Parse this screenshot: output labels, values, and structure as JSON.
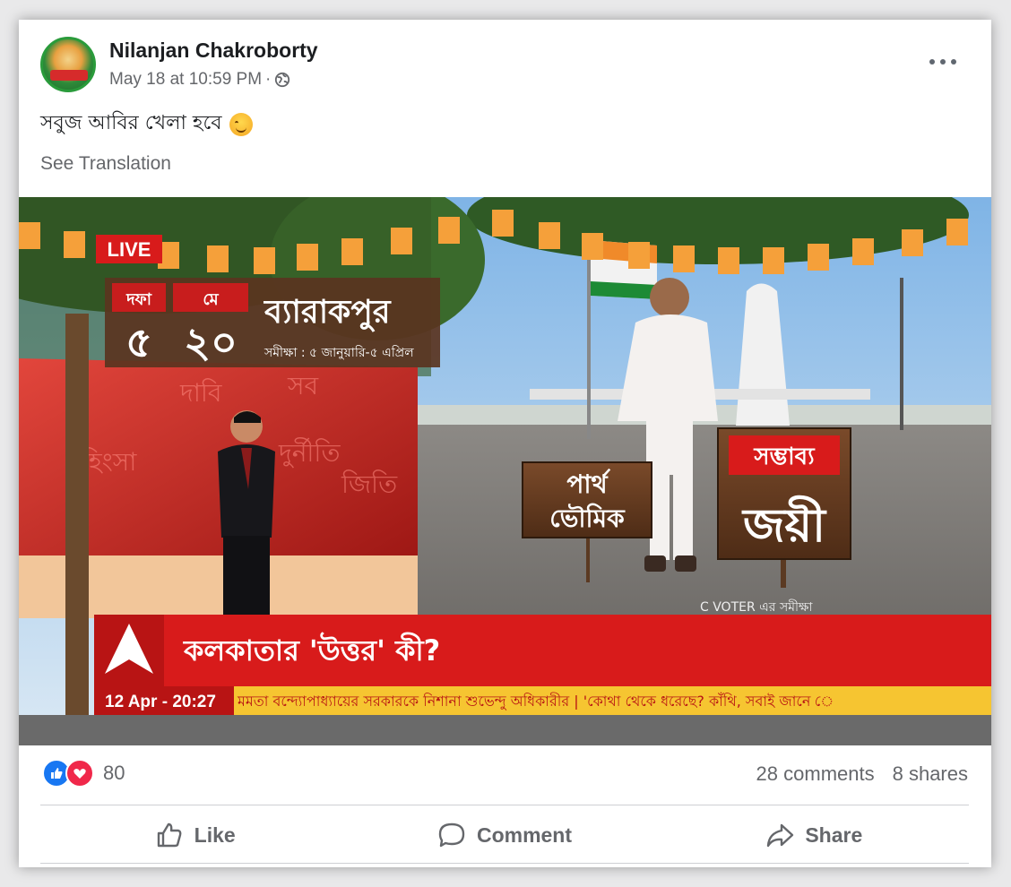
{
  "post": {
    "author": "Nilanjan Chakroborty",
    "timestamp": "May 18 at 10:59 PM",
    "separator": "·",
    "audience_icon": "globe-icon",
    "text": "সবুজ আবির খেলা হবে",
    "emoji": "smiling-face-emoji",
    "see_translation": "See Translation"
  },
  "image": {
    "live_label": "LIVE",
    "phase_label": "দফা",
    "phase_value": "৫",
    "month_label": "মে",
    "date_value": "২০",
    "constituency": "ব্যারাকপুর",
    "survey_period": "সমীক্ষা : ৫ জানুয়ারি-৫ এপ্রিল",
    "candidate_line1": "পার্থ",
    "candidate_line2": "ভৌমিক",
    "possible_label": "সম্ভাব্য",
    "winner_label": "জয়ী",
    "source_note": "C VOTER এর সমীক্ষা",
    "headline": "কলকাতার 'উত্তর' কী?",
    "ticker_time": "12 Apr - 20:27",
    "ticker_text": "মমতা বন্দ্যোপাধ্যায়ের সরকারকে নিশানা শুভেন্দু অধিকারীর   |   'কোথা থেকে ধরেছে? কাঁথি, সবাই জানে ে",
    "bg_words": [
      "দাবি",
      "দুর্নীতি",
      "হিংসা",
      "জিতি",
      "সব"
    ]
  },
  "engagement": {
    "reactions_count": "80",
    "comments": "28 comments",
    "shares": "8 shares"
  },
  "actions": {
    "like": "Like",
    "comment": "Comment",
    "share": "Share"
  },
  "colors": {
    "accent_red": "#d81b1b",
    "ticker_yellow": "#f6c531",
    "like_blue": "#1877f2",
    "love_red": "#f0284a",
    "muted_text": "#65676b"
  }
}
